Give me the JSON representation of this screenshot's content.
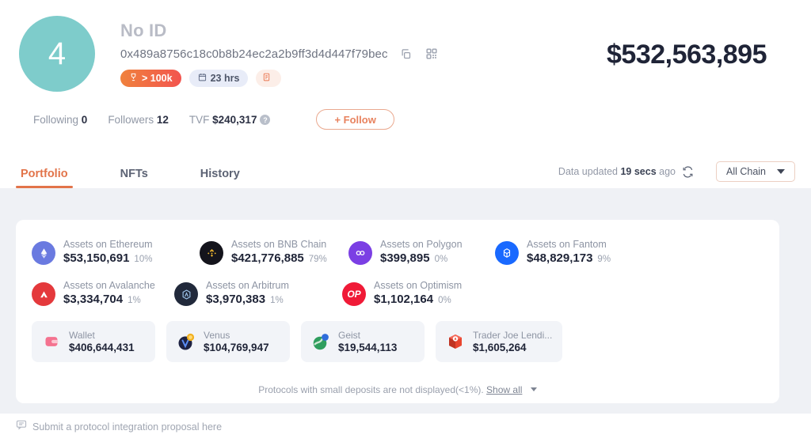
{
  "profile": {
    "avatar_rank": "4",
    "no_id_label": "No ID",
    "address": "0x489a8756c18c0b8b24ec2a2b9ff3d4d447f79bec",
    "copy_icon": "copy-icon",
    "qr_icon": "qr-code-icon",
    "badges": [
      {
        "icon": "trophy-icon",
        "label": "> 100k"
      },
      {
        "icon": "calendar-icon",
        "label": "23 hrs"
      },
      {
        "icon": "document-icon",
        "label": ""
      }
    ],
    "total_value": "$532,563,895"
  },
  "stats": {
    "following_label": "Following",
    "following_value": "0",
    "followers_label": "Followers",
    "followers_value": "12",
    "tvf_label": "TVF",
    "tvf_value": "$240,317",
    "help_icon": "question-mark-icon",
    "follow_button": "+ Follow"
  },
  "tabs": [
    {
      "label": "Portfolio",
      "active": true
    },
    {
      "label": "NFTs",
      "active": false
    },
    {
      "label": "History",
      "active": false
    }
  ],
  "toolbar": {
    "updated_prefix": "Data updated",
    "updated_value": "19 secs",
    "updated_suffix": "ago",
    "refresh_icon": "refresh-icon",
    "chain_filter": "All Chain",
    "chain_filter_caret": "chevron-down-icon"
  },
  "chains": [
    {
      "name": "Assets on Ethereum",
      "value": "$53,150,691",
      "pct": "10%",
      "icon": "ethereum-icon",
      "color": "#6a7ae0"
    },
    {
      "name": "Assets on BNB Chain",
      "value": "$421,776,885",
      "pct": "79%",
      "icon": "bnb-icon",
      "color": "#14141c"
    },
    {
      "name": "Assets on Polygon",
      "value": "$399,895",
      "pct": "0%",
      "icon": "polygon-icon",
      "color": "#7b3fe4"
    },
    {
      "name": "Assets on Fantom",
      "value": "$48,829,173",
      "pct": "9%",
      "icon": "fantom-icon",
      "color": "#1969ff"
    },
    {
      "name": "Assets on Avalanche",
      "value": "$3,334,704",
      "pct": "1%",
      "icon": "avalanche-icon",
      "color": "#e4393c"
    },
    {
      "name": "Assets on Arbitrum",
      "value": "$3,970,383",
      "pct": "1%",
      "icon": "arbitrum-icon",
      "color": "#21293b"
    },
    {
      "name": "Assets on Optimism",
      "value": "$1,102,164",
      "pct": "0%",
      "icon": "optimism-icon",
      "color": "#f01a37"
    }
  ],
  "protocols": [
    {
      "name": "Wallet",
      "value": "$406,644,431",
      "icon": "wallet-icon"
    },
    {
      "name": "Venus",
      "value": "$104,769,947",
      "icon": "venus-icon"
    },
    {
      "name": "Geist",
      "value": "$19,544,113",
      "icon": "geist-icon"
    },
    {
      "name": "Trader Joe Lendi...",
      "value": "$1,605,264",
      "icon": "trader-joe-icon"
    }
  ],
  "card_footer": {
    "note": "Protocols with small deposits are not displayed(<1%).",
    "show_all": "Show all"
  },
  "submit": {
    "icon": "chat-bubble-icon",
    "label": "Submit a protocol integration proposal here"
  },
  "colors": {
    "accent": "#e2744a",
    "page_bg": "#eff1f5",
    "avatar": "#7ecccb",
    "value_text": "#1f2437"
  }
}
